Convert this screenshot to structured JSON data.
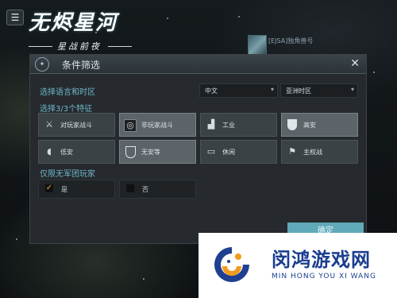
{
  "game": {
    "title": "无烬星河",
    "subtitle": "星战前夜",
    "menu_icon": "menu-icon"
  },
  "background_item": {
    "label": "[EJSA]独角兽号"
  },
  "dialog": {
    "title": "条件筛选",
    "header_icon": "faction-emblem-icon",
    "close_icon": "close-icon",
    "language_section": "选择语言和时区",
    "language_select": "中文",
    "timezone_select": "亚洲时区",
    "feature_section": "选择3/3个特征",
    "features": [
      {
        "label": "对玩家战斗",
        "icon": "crossed-swords-icon",
        "selected": false
      },
      {
        "label": "非玩家战斗",
        "icon": "target-icon",
        "selected": true
      },
      {
        "label": "工业",
        "icon": "factory-icon",
        "selected": false
      },
      {
        "label": "高安",
        "icon": "shield-filled-icon",
        "selected": true
      },
      {
        "label": "低安",
        "icon": "shield-half-icon",
        "selected": false
      },
      {
        "label": "无安等",
        "icon": "shield-outline-icon",
        "selected": true
      },
      {
        "label": "休闲",
        "icon": "chat-bubble-icon",
        "selected": false
      },
      {
        "label": "主权战",
        "icon": "flag-icon",
        "selected": false
      }
    ],
    "legion_section": "仅限无军团玩家",
    "options": [
      {
        "label": "是",
        "checked": true
      },
      {
        "label": "否",
        "checked": false
      }
    ],
    "confirm": "确定"
  },
  "watermark": {
    "name": "闵鸿游戏网",
    "pinyin": "MIN HONG YOU XI WANG"
  }
}
